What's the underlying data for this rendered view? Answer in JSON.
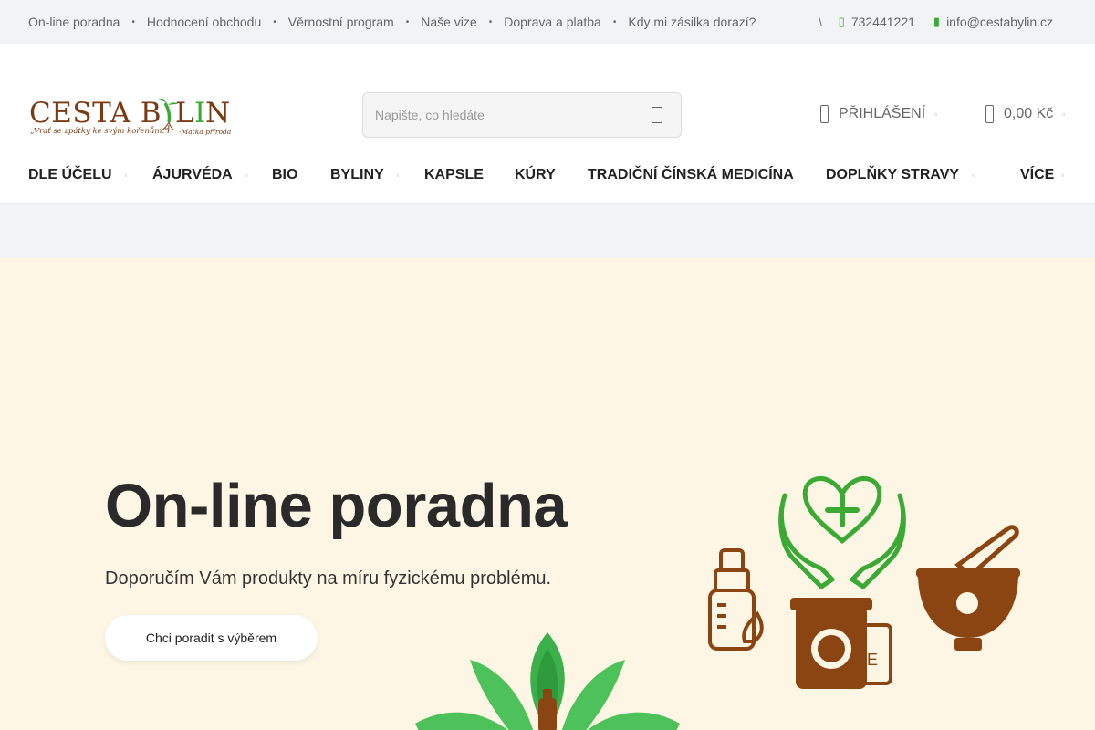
{
  "topbar": {
    "links": [
      "On-line poradna",
      "Hodnocení obchodu",
      "Věrnostní program",
      "Naše vize",
      "Doprava a platba",
      "Kdy mi zásilka dorazí?"
    ],
    "separator": "•",
    "checkmark": "\\",
    "phone": "732441221",
    "email": "info@cestabylin.cz"
  },
  "header": {
    "logo_text": "CESTA BYLIN",
    "logo_tagline": "„Vrať se zpátky ke svým kořenům.\" -Matka příroda",
    "search_placeholder": "Napište, co hledáte",
    "login_label": "PŘIHLÁŠENÍ",
    "cart_total": "0,00 Kč"
  },
  "nav": {
    "items": [
      {
        "label": "DLE ÚČELU",
        "dropdown": true
      },
      {
        "label": "ÁJURVÉDA",
        "dropdown": true
      },
      {
        "label": "BIO",
        "dropdown": false
      },
      {
        "label": "BYLINY",
        "dropdown": true
      },
      {
        "label": "KAPSLE",
        "dropdown": false
      },
      {
        "label": "KÚRY",
        "dropdown": false
      },
      {
        "label": "TRADIČNÍ ČÍNSKÁ MEDICÍNA",
        "dropdown": false
      },
      {
        "label": "DOPLŇKY STRAVY",
        "dropdown": true
      }
    ],
    "more_label": "VÍCE"
  },
  "hero": {
    "title": "On-line poradna",
    "subtitle": "Doporučím Vám produkty na míru fyzickému problému.",
    "cta_label": "Chci poradit s výběrem"
  },
  "colors": {
    "hero_bg": "#fdf6e4",
    "brand_brown": "#7a3b14",
    "brand_green": "#3aaa35",
    "topbar_bg": "#f2f3f4"
  },
  "icons": {
    "phone": "phone-icon",
    "email": "email-icon",
    "search": "search-icon",
    "user": "user-icon",
    "cart": "cart-icon",
    "dropdown": "chevron-down-icon"
  }
}
